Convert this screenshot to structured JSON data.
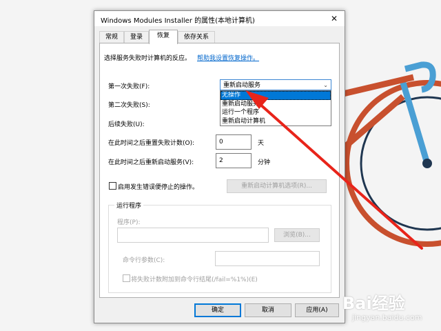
{
  "window": {
    "title": "Windows Modules Installer 的属性(本地计算机)",
    "close_symbol": "✕"
  },
  "tabs": [
    {
      "label": "常规"
    },
    {
      "label": "登录"
    },
    {
      "label": "恢复"
    },
    {
      "label": "依存关系"
    }
  ],
  "recovery": {
    "intro": "选择服务失败时计算机的反应。",
    "help_link": "帮助我设置恢复操作。",
    "first_failure_label": "第一次失败(F):",
    "first_failure_value": "重新启动服务",
    "second_failure_label": "第二次失败(S):",
    "subsequent_failure_label": "后续失败(U):",
    "dropdown_options": [
      "无操作",
      "重新启动服务",
      "运行一个程序",
      "重新启动计算机"
    ],
    "reset_count_label": "在此时间之后重置失败计数(O):",
    "reset_count_value": "0",
    "reset_count_unit": "天",
    "restart_service_label": "在此时间之后重新启动服务(V):",
    "restart_service_value": "2",
    "restart_service_unit": "分钟",
    "enable_stop_actions_label": "启用发生错误便停止的操作。",
    "restart_computer_options_button": "重新启动计算机选项(R)..."
  },
  "run_program": {
    "group_title": "运行程序",
    "program_label": "程序(P):",
    "browse_button": "浏览(B)...",
    "cmd_params_label": "命令行参数(C):",
    "append_fail_count_label": "将失败计数附加到命令行结尾(/fail=%1%)(E)"
  },
  "buttons": {
    "ok": "确定",
    "cancel": "取消",
    "apply": "应用(A)"
  },
  "watermark": {
    "logo": "Bai经验",
    "url": "jingyan.baidu.com"
  },
  "colors": {
    "accent": "#0078d7",
    "arrow": "#e8241a",
    "bike_red": "#c8502e",
    "bike_blue": "#4a9fd4"
  }
}
